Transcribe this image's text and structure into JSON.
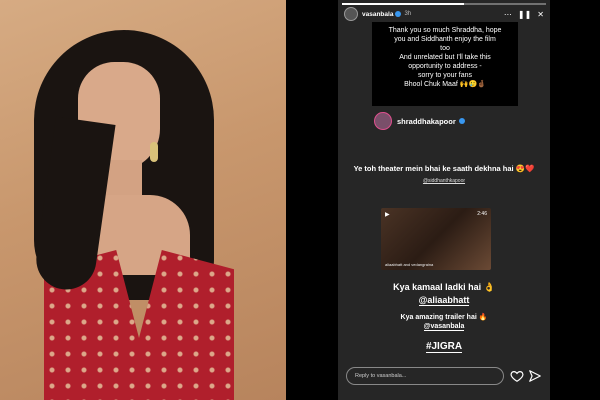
{
  "story": {
    "username": "vasanbala",
    "time": "3h",
    "progress": 0.6,
    "reply_card": {
      "lines": [
        "Thank you so much Shraddha, hope",
        "you and Siddhanth enjoy the film",
        "too",
        "And unrelated but I'll take this",
        "opportunity to address -",
        "sorry to your fans",
        "Bhool Chuk Maaf 🙌🥲🤞🏾"
      ]
    },
    "mention": {
      "username": "shraddhakapoor"
    },
    "caption1": "Ye toh theater mein bhai ke saath dekhna hai 😍❤️",
    "tag1": "@siddhanthkapoor",
    "video": {
      "time": "2:46",
      "credit": "aliaabhatt and vedangraina"
    },
    "caption2": "Kya kamaal ladki hai 👌",
    "mention2": "@aliaabhatt",
    "caption3": "Kya amazing trailer hai 🔥",
    "mention3": "@vasanbala",
    "hashtag": "#JIGRA",
    "reply": {
      "placeholder": "Reply to vasanbala..."
    },
    "icons": {
      "heart": "heart-icon",
      "send": "send-icon",
      "more": "more-icon",
      "pause": "pause-icon",
      "close": "close-icon",
      "play": "play-icon"
    }
  }
}
